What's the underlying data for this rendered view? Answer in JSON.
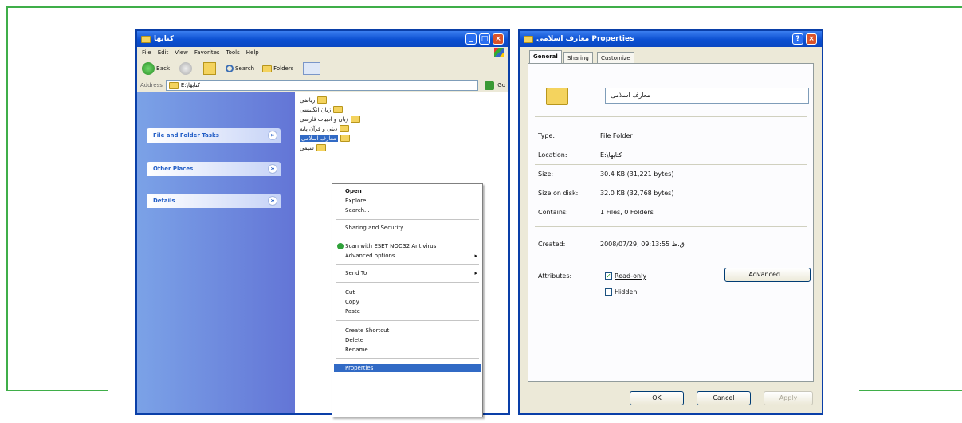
{
  "explorer": {
    "title": "کتابها",
    "menu": [
      "File",
      "Edit",
      "View",
      "Favorites",
      "Tools",
      "Help"
    ],
    "toolbar": {
      "back": "Back",
      "search": "Search",
      "folders": "Folders"
    },
    "address": {
      "label": "Address",
      "value": "E:\\کتابها",
      "go": "Go"
    },
    "tasks": [
      {
        "label": "File and Folder Tasks"
      },
      {
        "label": "Other Places"
      },
      {
        "label": "Details"
      }
    ],
    "files": [
      "ریاضی",
      "زبان انگلیسی",
      "زبان و ادبیات فارسی",
      "دینی و قرآن پایه",
      "معارف اسلامی",
      "شیمی"
    ],
    "context_menu": {
      "open": "Open",
      "explore": "Explore",
      "search": "Search...",
      "sharing": "Sharing and Security...",
      "scan": "Scan with ESET NOD32 Antivirus",
      "advanced": "Advanced options",
      "send_to": "Send To",
      "cut": "Cut",
      "copy": "Copy",
      "paste": "Paste",
      "create_shortcut": "Create Shortcut",
      "delete": "Delete",
      "rename": "Rename",
      "properties": "Properties"
    }
  },
  "properties": {
    "title": "معارف اسلامی Properties",
    "tabs": [
      "General",
      "Sharing",
      "Customize"
    ],
    "name_value": "معارف اسلامی",
    "rows": [
      {
        "label": "Type:",
        "value": "File Folder"
      },
      {
        "label": "Location:",
        "value": "E:\\کتابها"
      },
      {
        "label": "Size:",
        "value": "30.4 KB (31,221 bytes)"
      },
      {
        "label": "Size on disk:",
        "value": "32.0 KB (32,768 bytes)"
      },
      {
        "label": "Contains:",
        "value": "1 Files, 0 Folders"
      }
    ],
    "created": {
      "label": "Created:",
      "value": "2008/07/29, 09:13:55 ق.ظ"
    },
    "attributes": {
      "label": "Attributes:",
      "readonly": "Read-only",
      "hidden": "Hidden",
      "advanced": "Advanced..."
    },
    "buttons": {
      "ok": "OK",
      "cancel": "Cancel",
      "apply": "Apply"
    }
  }
}
